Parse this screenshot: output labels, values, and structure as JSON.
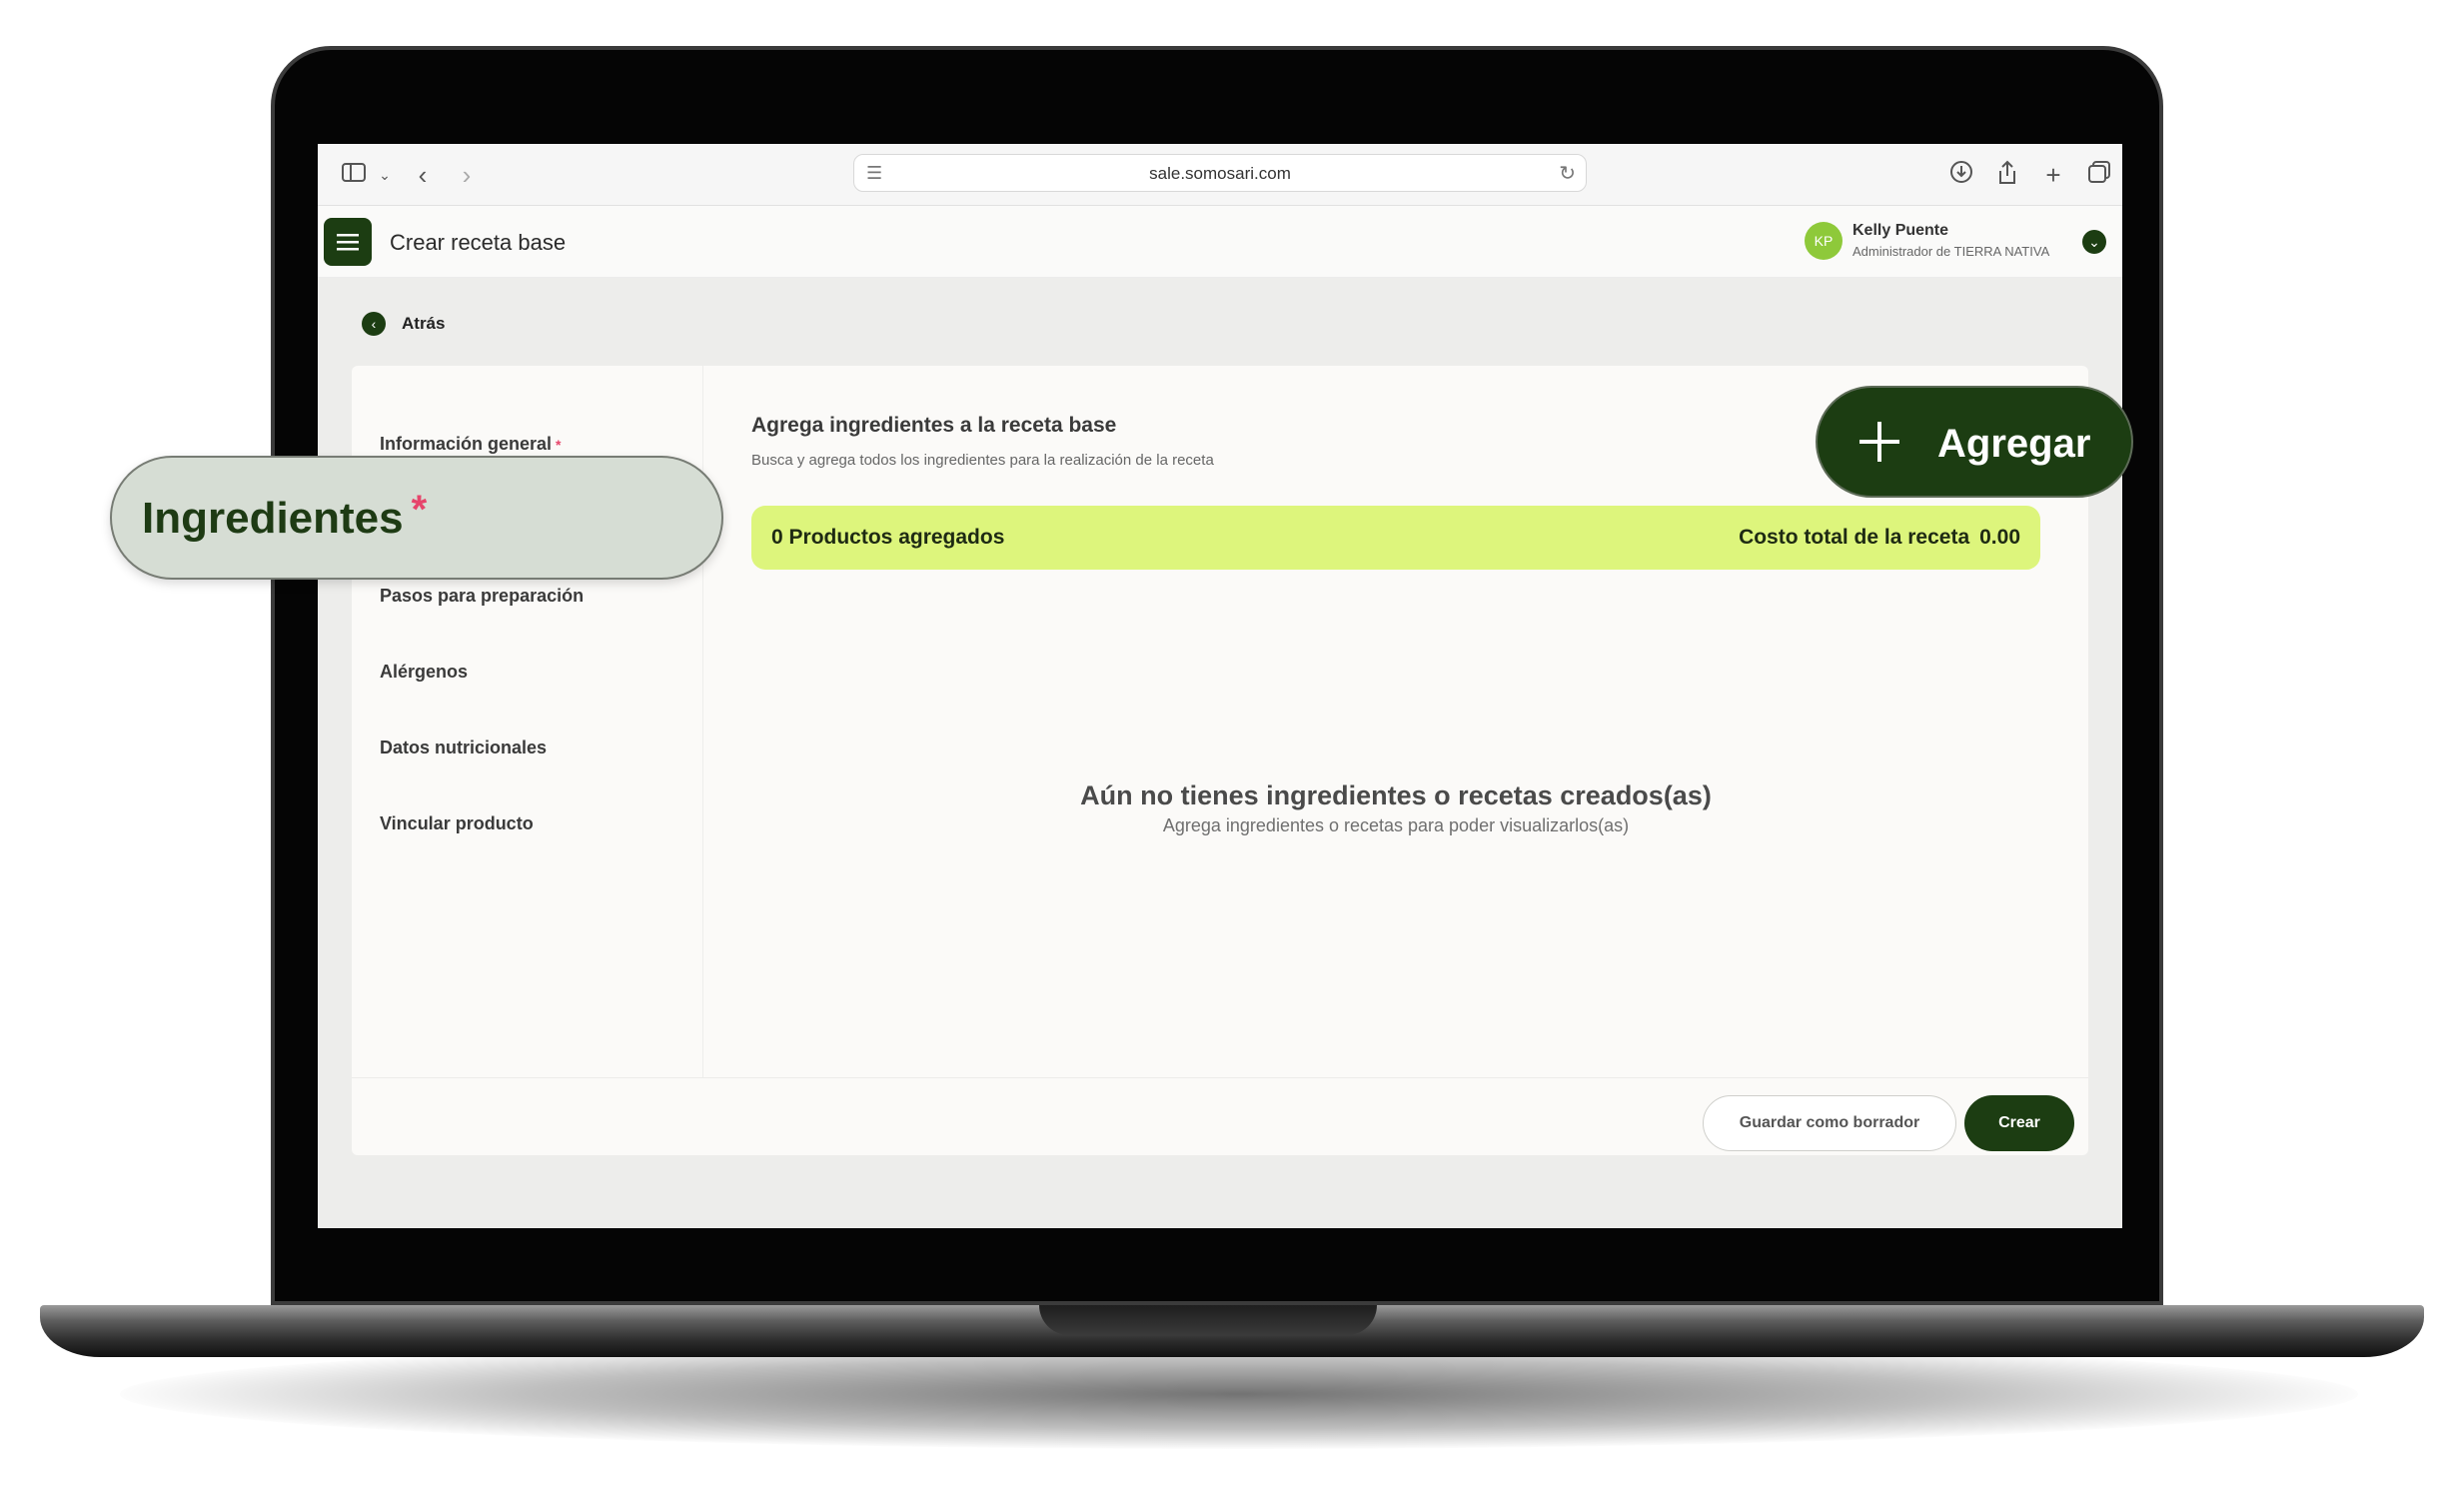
{
  "browser": {
    "url": "sale.somosari.com"
  },
  "header": {
    "page_title": "Crear receta base",
    "user": {
      "initials": "KP",
      "name": "Kelly Puente",
      "role": "Administrador de TIERRA NATIVA"
    }
  },
  "back_label": "Atrás",
  "sidebar": {
    "items": [
      {
        "label": "Información general",
        "required": "*"
      },
      {
        "label": "Ingredientes",
        "required": "*"
      },
      {
        "label": "Pasos para preparación"
      },
      {
        "label": "Alérgenos"
      },
      {
        "label": "Datos nutricionales"
      },
      {
        "label": "Vincular producto"
      }
    ]
  },
  "main": {
    "title": "Agrega ingredientes a la receta base",
    "subtitle": "Busca y agrega todos los ingredientes para la realización de la receta",
    "add_button": "Agregar",
    "summary": {
      "products_added": "0 Productos agregados",
      "total_cost_label": "Costo total de la receta",
      "total_cost_value": "0.00"
    },
    "empty_state": {
      "title": "Aún no tienes ingredientes o recetas creados(as)",
      "subtitle": "Agrega ingredientes o recetas para poder visualizarlos(as)"
    }
  },
  "footer": {
    "draft_button": "Guardar como borrador",
    "create_button": "Crear"
  },
  "colors": {
    "brand_dark_green": "#1c3d12",
    "summary_lime": "#ddf57c",
    "required_pink": "#e6456b",
    "avatar_green": "#8ec93a"
  }
}
